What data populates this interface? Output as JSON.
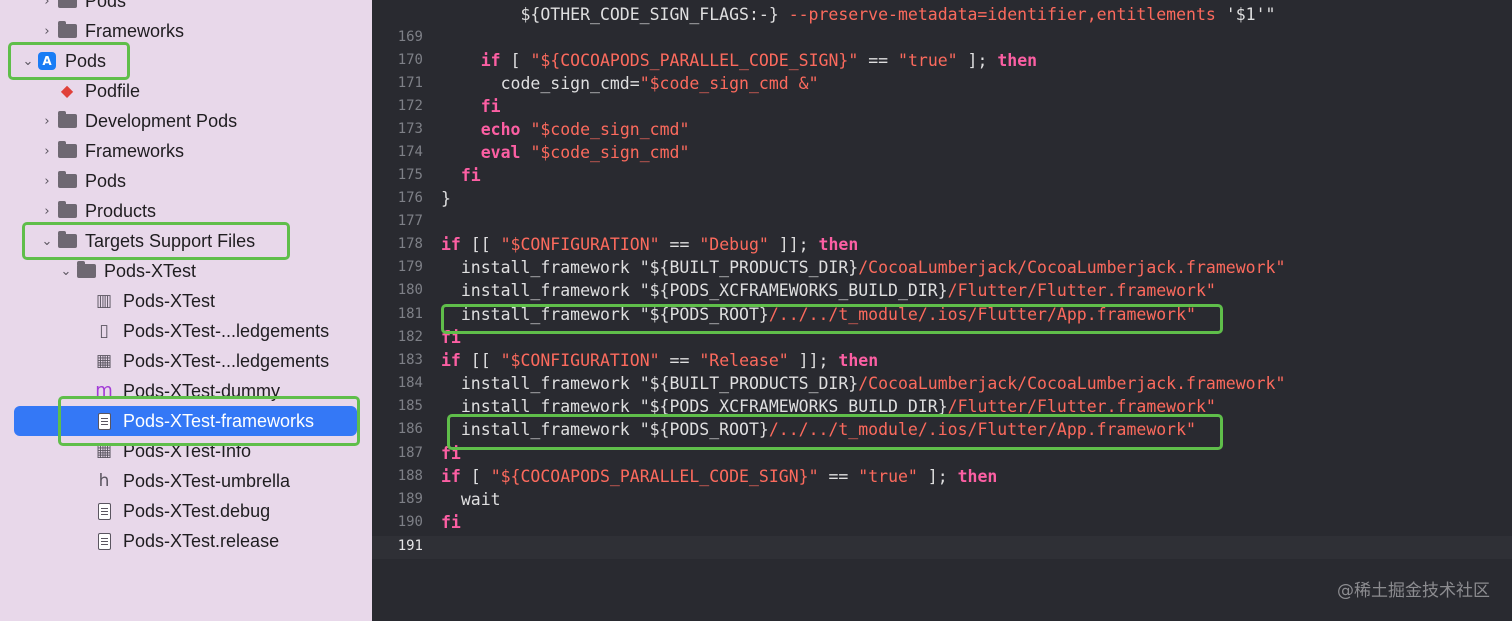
{
  "navigator": {
    "items": [
      {
        "label": "Pods",
        "icon": "folder-icon",
        "chevron": "›"
      },
      {
        "label": "Frameworks",
        "icon": "folder-icon",
        "chevron": "›"
      },
      {
        "label": "Pods",
        "icon": "app-project-icon",
        "chevron": "⌄"
      },
      {
        "label": "Podfile",
        "icon": "ruby-icon",
        "chevron": ""
      },
      {
        "label": "Development Pods",
        "icon": "folder-icon",
        "chevron": "›"
      },
      {
        "label": "Frameworks",
        "icon": "folder-icon",
        "chevron": "›"
      },
      {
        "label": "Pods",
        "icon": "folder-icon",
        "chevron": "›"
      },
      {
        "label": "Products",
        "icon": "folder-icon",
        "chevron": "›"
      },
      {
        "label": "Targets Support Files",
        "icon": "folder-icon",
        "chevron": "⌄"
      },
      {
        "label": "Pods-XTest",
        "icon": "folder-icon",
        "chevron": "⌄"
      },
      {
        "label": "Pods-XTest",
        "icon": "map-icon",
        "chevron": ""
      },
      {
        "label": "Pods-XTest-...ledgements",
        "icon": "book-icon",
        "chevron": ""
      },
      {
        "label": "Pods-XTest-...ledgements",
        "icon": "table-icon",
        "chevron": ""
      },
      {
        "label": "Pods-XTest-dummy",
        "icon": "m-file-icon",
        "chevron": ""
      },
      {
        "label": "Pods-XTest-frameworks",
        "icon": "document-icon",
        "chevron": ""
      },
      {
        "label": "Pods-XTest-Info",
        "icon": "table-icon",
        "chevron": ""
      },
      {
        "label": "Pods-XTest-umbrella",
        "icon": "h-file-icon",
        "chevron": ""
      },
      {
        "label": "Pods-XTest.debug",
        "icon": "document-icon",
        "chevron": ""
      },
      {
        "label": "Pods-XTest.release",
        "icon": "document-icon",
        "chevron": ""
      }
    ],
    "selected_label": "Pods-XTest-frameworks"
  },
  "editor": {
    "current_line": "191",
    "lines": [
      {
        "no": "",
        "tokens": [
          {
            "t": "        ${OTHER_CODE_SIGN_FLAGS:-} ",
            "c": "plain"
          },
          {
            "t": "--preserve-metadata=identifier,entitlements ",
            "c": "str"
          },
          {
            "t": "'$1'\"",
            "c": "plain"
          }
        ]
      },
      {
        "no": "169",
        "tokens": []
      },
      {
        "no": "170",
        "tokens": [
          {
            "t": "    ",
            "c": "plain"
          },
          {
            "t": "if",
            "c": "kw"
          },
          {
            "t": " [ ",
            "c": "plain"
          },
          {
            "t": "\"${COCOAPODS_PARALLEL_CODE_SIGN}\"",
            "c": "str"
          },
          {
            "t": " == ",
            "c": "plain"
          },
          {
            "t": "\"true\"",
            "c": "str"
          },
          {
            "t": " ]; ",
            "c": "plain"
          },
          {
            "t": "then",
            "c": "kw"
          }
        ]
      },
      {
        "no": "171",
        "tokens": [
          {
            "t": "      code_sign_cmd=",
            "c": "plain"
          },
          {
            "t": "\"$code_sign_cmd &\"",
            "c": "str"
          }
        ]
      },
      {
        "no": "172",
        "tokens": [
          {
            "t": "    ",
            "c": "plain"
          },
          {
            "t": "fi",
            "c": "kw"
          }
        ]
      },
      {
        "no": "173",
        "tokens": [
          {
            "t": "    ",
            "c": "plain"
          },
          {
            "t": "echo",
            "c": "kw"
          },
          {
            "t": " ",
            "c": "plain"
          },
          {
            "t": "\"$code_sign_cmd\"",
            "c": "str"
          }
        ]
      },
      {
        "no": "174",
        "tokens": [
          {
            "t": "    ",
            "c": "plain"
          },
          {
            "t": "eval",
            "c": "kw"
          },
          {
            "t": " ",
            "c": "plain"
          },
          {
            "t": "\"$code_sign_cmd\"",
            "c": "str"
          }
        ]
      },
      {
        "no": "175",
        "tokens": [
          {
            "t": "  ",
            "c": "plain"
          },
          {
            "t": "fi",
            "c": "kw"
          }
        ]
      },
      {
        "no": "176",
        "tokens": [
          {
            "t": "}",
            "c": "plain"
          }
        ]
      },
      {
        "no": "177",
        "tokens": []
      },
      {
        "no": "178",
        "tokens": [
          {
            "t": "if",
            "c": "kw"
          },
          {
            "t": " [[ ",
            "c": "plain"
          },
          {
            "t": "\"$CONFIGURATION\"",
            "c": "str"
          },
          {
            "t": " == ",
            "c": "plain"
          },
          {
            "t": "\"Debug\"",
            "c": "str"
          },
          {
            "t": " ]]; ",
            "c": "plain"
          },
          {
            "t": "then",
            "c": "kw"
          }
        ]
      },
      {
        "no": "179",
        "tokens": [
          {
            "t": "  install_framework ",
            "c": "plain"
          },
          {
            "t": "\"${BUILT_PRODUCTS_DIR}",
            "c": "plain"
          },
          {
            "t": "/CocoaLumberjack/CocoaLumberjack.framework\"",
            "c": "str"
          }
        ]
      },
      {
        "no": "180",
        "tokens": [
          {
            "t": "  install_framework ",
            "c": "plain"
          },
          {
            "t": "\"${PODS_XCFRAMEWORKS_BUILD_DIR}",
            "c": "plain"
          },
          {
            "t": "/Flutter/Flutter.framework\"",
            "c": "str"
          }
        ]
      },
      {
        "no": "181",
        "tokens": [
          {
            "t": "  install_framework ",
            "c": "plain"
          },
          {
            "t": "\"${PODS_ROOT}",
            "c": "plain"
          },
          {
            "t": "/../../t_module/.ios/Flutter/App.framework\"",
            "c": "str"
          }
        ]
      },
      {
        "no": "182",
        "tokens": [
          {
            "t": "fi",
            "c": "kw"
          }
        ]
      },
      {
        "no": "183",
        "tokens": [
          {
            "t": "if",
            "c": "kw"
          },
          {
            "t": " [[ ",
            "c": "plain"
          },
          {
            "t": "\"$CONFIGURATION\"",
            "c": "str"
          },
          {
            "t": " == ",
            "c": "plain"
          },
          {
            "t": "\"Release\"",
            "c": "str"
          },
          {
            "t": " ]]; ",
            "c": "plain"
          },
          {
            "t": "then",
            "c": "kw"
          }
        ]
      },
      {
        "no": "184",
        "tokens": [
          {
            "t": "  install_framework ",
            "c": "plain"
          },
          {
            "t": "\"${BUILT_PRODUCTS_DIR}",
            "c": "plain"
          },
          {
            "t": "/CocoaLumberjack/CocoaLumberjack.framework\"",
            "c": "str"
          }
        ]
      },
      {
        "no": "185",
        "tokens": [
          {
            "t": "  install_framework ",
            "c": "plain"
          },
          {
            "t": "\"${PODS_XCFRAMEWORKS_BUILD_DIR}",
            "c": "plain"
          },
          {
            "t": "/Flutter/Flutter.framework\"",
            "c": "str"
          }
        ]
      },
      {
        "no": "186",
        "tokens": [
          {
            "t": "  install_framework ",
            "c": "plain"
          },
          {
            "t": "\"${PODS_ROOT}",
            "c": "plain"
          },
          {
            "t": "/../../t_module/.ios/Flutter/App.framework\"",
            "c": "str"
          }
        ]
      },
      {
        "no": "187",
        "tokens": [
          {
            "t": "fi",
            "c": "kw"
          }
        ]
      },
      {
        "no": "188",
        "tokens": [
          {
            "t": "if",
            "c": "kw"
          },
          {
            "t": " [ ",
            "c": "plain"
          },
          {
            "t": "\"${COCOAPODS_PARALLEL_CODE_SIGN}\"",
            "c": "str"
          },
          {
            "t": " == ",
            "c": "plain"
          },
          {
            "t": "\"true\"",
            "c": "str"
          },
          {
            "t": " ]; ",
            "c": "plain"
          },
          {
            "t": "then",
            "c": "kw"
          }
        ]
      },
      {
        "no": "189",
        "tokens": [
          {
            "t": "  wait",
            "c": "plain"
          }
        ]
      },
      {
        "no": "190",
        "tokens": [
          {
            "t": "fi",
            "c": "kw"
          }
        ]
      },
      {
        "no": "191",
        "tokens": []
      }
    ]
  },
  "watermark": "@稀土掘金技术社区",
  "colors": {
    "highlight": "#5fbe4a",
    "selection": "#3478f6",
    "keyword": "#fc5fa3",
    "string": "#fc6a5d"
  }
}
